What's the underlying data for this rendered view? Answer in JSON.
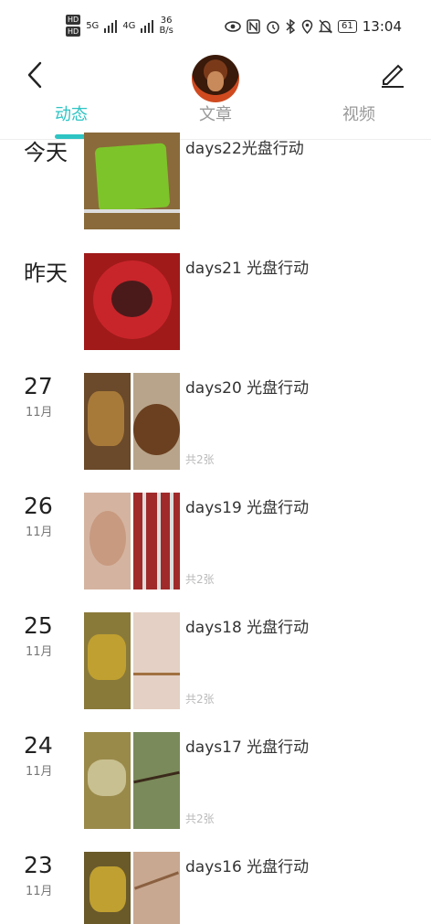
{
  "status_bar": {
    "hd_1": "HD",
    "hd_2": "HD",
    "net_1": "5G",
    "net_2": "4G",
    "speed_value": "36",
    "speed_unit": "B/s",
    "battery": "61",
    "time": "13:04",
    "icons": [
      "eye-icon",
      "nfc-icon",
      "alarm-icon",
      "bluetooth-icon",
      "location-icon",
      "mute-bell-icon"
    ]
  },
  "header": {
    "back_icon": "chevron-left-icon",
    "edit_icon": "pencil-icon",
    "tabs": [
      {
        "label": "动态",
        "active": true
      },
      {
        "label": "文章",
        "active": false
      },
      {
        "label": "视频",
        "active": false
      }
    ]
  },
  "colors": {
    "accent": "#2ec4c4",
    "text": "#222222",
    "muted": "#999999",
    "hint": "#bbbbbb"
  },
  "entries": [
    {
      "date_word": "今天",
      "title": "days22光盘行动",
      "count": "",
      "images": [
        "#8a6a3a",
        "#7dc42a"
      ]
    },
    {
      "date_word": "昨天",
      "title": "days21 光盘行动",
      "count": "",
      "images": [
        "#c8252a"
      ]
    },
    {
      "day": "27",
      "month": "11月",
      "title": "days20 光盘行动",
      "count": "共2张",
      "images": [
        "#6a4a2a",
        "#b8a48a"
      ]
    },
    {
      "day": "26",
      "month": "11月",
      "title": "days19 光盘行动",
      "count": "共2张",
      "images": [
        "#d4b4a0",
        "#a02a2a"
      ]
    },
    {
      "day": "25",
      "month": "11月",
      "title": "days18 光盘行动",
      "count": "共2张",
      "images": [
        "#8a7a3a",
        "#e4d0c4"
      ]
    },
    {
      "day": "24",
      "month": "11月",
      "title": "days17 光盘行动",
      "count": "共2张",
      "images": [
        "#9a8a4a",
        "#7a8a5a"
      ]
    },
    {
      "day": "23",
      "month": "11月",
      "title": "days16 光盘行动",
      "count": "",
      "images": [
        "#6a5a2a",
        "#c8a890"
      ]
    }
  ]
}
